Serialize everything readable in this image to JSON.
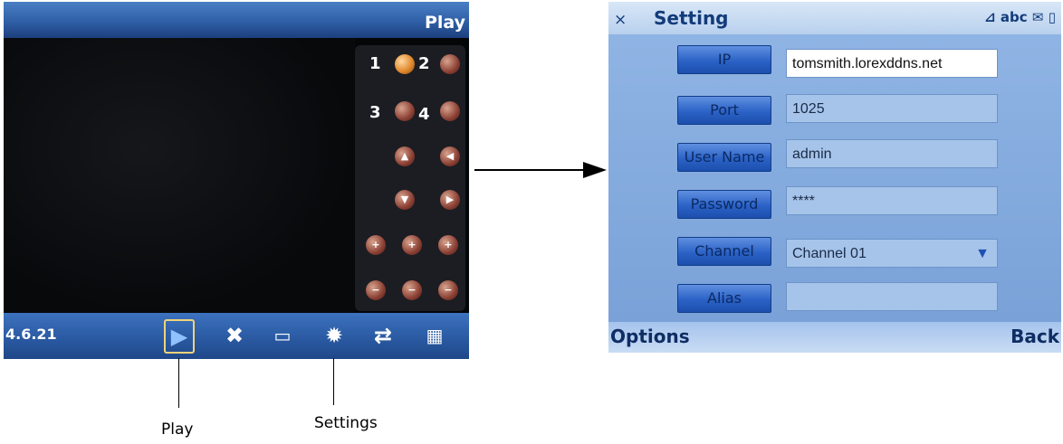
{
  "left_screen": {
    "title": "Play",
    "version": "4.6.21",
    "channel_numbers": [
      "1",
      "2",
      "3",
      "4"
    ],
    "toolbar_icons": [
      "play-icon",
      "close-icon",
      "snapshot-icon",
      "settings-icon",
      "swap-icon",
      "calendar-icon"
    ]
  },
  "callouts": {
    "play_label": "Play",
    "settings_label": "Settings"
  },
  "right_screen": {
    "close_glyph": "×",
    "title": "Setting",
    "status_text": "abc",
    "fields": {
      "ip": {
        "label": "IP",
        "value": "tomsmith.lorexddns.net"
      },
      "port": {
        "label": "Port",
        "value": "1025"
      },
      "username": {
        "label": "User Name",
        "value": "admin"
      },
      "password": {
        "label": "Password",
        "value": "****"
      },
      "channel": {
        "label": "Channel",
        "value": "Channel 01"
      },
      "alias": {
        "label": "Alias",
        "value": ""
      }
    },
    "softkeys": {
      "left": "Options",
      "right": "Back"
    }
  },
  "colors": {
    "toolbar_blue": "#2958a0",
    "highlight_yellow": "#f1d37a",
    "form_bg": "#7aa2d8"
  }
}
